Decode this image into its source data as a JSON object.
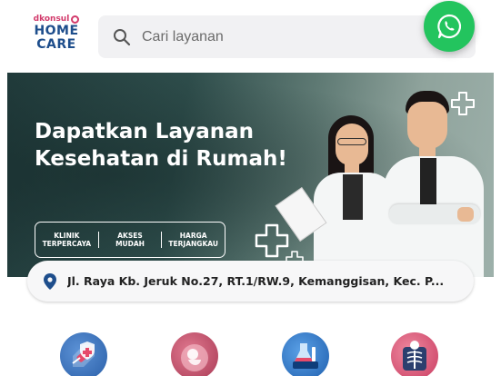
{
  "header": {
    "logo": {
      "brand": "dkonsul",
      "line1": "HOME",
      "line2": "CARE"
    },
    "search": {
      "placeholder": "Cari layanan"
    },
    "whatsapp_icon": "whatsapp-icon"
  },
  "banner": {
    "headline_line1": "Dapatkan Layanan",
    "headline_line2": "Kesehatan di Rumah!",
    "features": [
      "KLINIK\nTERPERCAYA",
      "AKSES\nMUDAH",
      "HARGA\nTERJANGKAU"
    ]
  },
  "address": {
    "icon": "location-pin-icon",
    "text": "Jl. Raya Kb. Jeruk No.27, RT.1/RW.9, Kemanggisan, Kec. P..."
  },
  "services": [
    {
      "icon": "vaccine-icon",
      "color": "#2a6fb5"
    },
    {
      "icon": "pregnancy-icon",
      "color": "#c14b6a"
    },
    {
      "icon": "lab-test-icon",
      "color": "#2b73c2"
    },
    {
      "icon": "xray-icon",
      "color": "#d24a6c"
    }
  ],
  "colors": {
    "brand_blue": "#1e4e8c",
    "brand_pink": "#d23a6b",
    "whatsapp_green": "#23c45e"
  }
}
